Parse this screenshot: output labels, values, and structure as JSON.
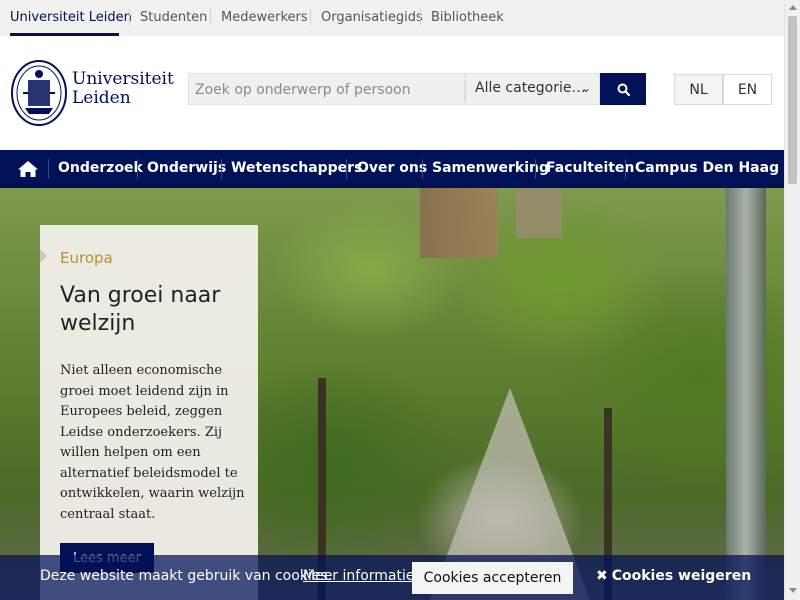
{
  "top_nav": {
    "items": [
      "Universiteit Leiden",
      "Studenten",
      "Medewerkers",
      "Organisatiegids",
      "Bibliotheek"
    ]
  },
  "header": {
    "logo_line1": "Universiteit",
    "logo_line2": "Leiden",
    "search_placeholder": "Zoek op onderwerp of persoon",
    "category_value": "Alle categorie…",
    "languages": [
      "NL",
      "EN"
    ],
    "active_language": "NL"
  },
  "main_nav": {
    "home_icon": "home-icon",
    "items": [
      "Onderzoek",
      "Onderwijs",
      "Wetenschappers",
      "Over ons",
      "Samenwerking",
      "Faculteiten",
      "Campus Den Haag"
    ]
  },
  "hero": {
    "eyebrow": "Europa",
    "title": "Van groei naar welzijn",
    "body": "Niet alleen economische groei moet leidend zijn in Europees beleid, zeggen Leidse onderzoekers. Zij willen helpen om een alternatief beleidsmodel te ontwikkelen, waarin welzijn centraal staat.",
    "button": "Lees meer"
  },
  "cookie_bar": {
    "message": "Deze website maakt gebruik van cookies.",
    "link": "Meer informatie.",
    "accept": "Cookies accepteren",
    "refuse": "Cookies weigeren"
  },
  "colors": {
    "brand_navy": "#001158",
    "accent_gold": "#b6903d"
  }
}
